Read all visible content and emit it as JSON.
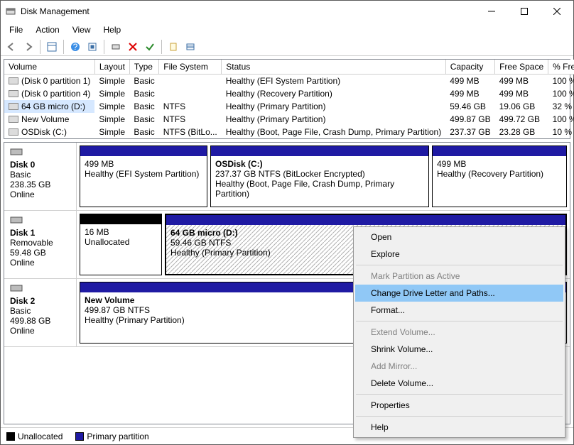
{
  "window": {
    "title": "Disk Management"
  },
  "menu": {
    "file": "File",
    "action": "Action",
    "view": "View",
    "help": "Help"
  },
  "columns": {
    "volume": "Volume",
    "layout": "Layout",
    "type": "Type",
    "fs": "File System",
    "status": "Status",
    "capacity": "Capacity",
    "free": "Free Space",
    "pctfree": "% Free"
  },
  "volumes": [
    {
      "name": "(Disk 0 partition 1)",
      "layout": "Simple",
      "type": "Basic",
      "fs": "",
      "status": "Healthy (EFI System Partition)",
      "capacity": "499 MB",
      "free": "499 MB",
      "pct": "100 %"
    },
    {
      "name": "(Disk 0 partition 4)",
      "layout": "Simple",
      "type": "Basic",
      "fs": "",
      "status": "Healthy (Recovery Partition)",
      "capacity": "499 MB",
      "free": "499 MB",
      "pct": "100 %"
    },
    {
      "name": "64 GB micro (D:)",
      "layout": "Simple",
      "type": "Basic",
      "fs": "NTFS",
      "status": "Healthy (Primary Partition)",
      "capacity": "59.46 GB",
      "free": "19.06 GB",
      "pct": "32 %",
      "selected": true
    },
    {
      "name": "New Volume",
      "layout": "Simple",
      "type": "Basic",
      "fs": "NTFS",
      "status": "Healthy (Primary Partition)",
      "capacity": "499.87 GB",
      "free": "499.72 GB",
      "pct": "100 %"
    },
    {
      "name": "OSDisk (C:)",
      "layout": "Simple",
      "type": "Basic",
      "fs": "NTFS (BitLo...",
      "status": "Healthy (Boot, Page File, Crash Dump, Primary Partition)",
      "capacity": "237.37 GB",
      "free": "23.28 GB",
      "pct": "10 %"
    }
  ],
  "disks": {
    "d0": {
      "name": "Disk 0",
      "type": "Basic",
      "size": "238.35 GB",
      "state": "Online",
      "p0": {
        "line1": "",
        "line2": "499 MB",
        "line3": "Healthy (EFI System Partition)"
      },
      "p1": {
        "line1": "OSDisk (C:)",
        "line2": "237.37 GB NTFS (BitLocker Encrypted)",
        "line3": "Healthy (Boot, Page File, Crash Dump, Primary Partition)"
      },
      "p2": {
        "line1": "",
        "line2": "499 MB",
        "line3": "Healthy (Recovery Partition)"
      }
    },
    "d1": {
      "name": "Disk 1",
      "type": "Removable",
      "size": "59.48 GB",
      "state": "Online",
      "p0": {
        "line1": "",
        "line2": "16 MB",
        "line3": "Unallocated"
      },
      "p1": {
        "line1": "64 GB micro  (D:)",
        "line2": "59.46 GB NTFS",
        "line3": "Healthy (Primary Partition)"
      }
    },
    "d2": {
      "name": "Disk 2",
      "type": "Basic",
      "size": "499.88 GB",
      "state": "Online",
      "p0": {
        "line1": "New Volume",
        "line2": "499.87 GB NTFS",
        "line3": "Healthy (Primary Partition)"
      }
    }
  },
  "legend": {
    "unalloc": "Unallocated",
    "primary": "Primary partition"
  },
  "ctx": {
    "open": "Open",
    "explore": "Explore",
    "mark": "Mark Partition as Active",
    "change": "Change Drive Letter and Paths...",
    "format": "Format...",
    "extend": "Extend Volume...",
    "shrink": "Shrink Volume...",
    "mirror": "Add Mirror...",
    "delete": "Delete Volume...",
    "props": "Properties",
    "help": "Help"
  }
}
